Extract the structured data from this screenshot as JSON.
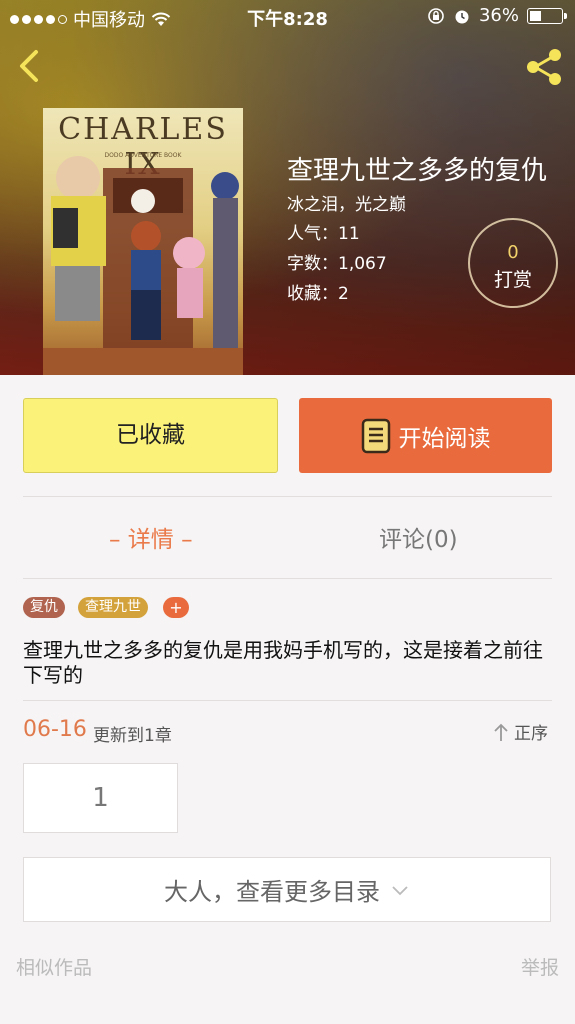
{
  "status_bar": {
    "carrier": "中国移动",
    "time": "下午8:28",
    "battery": "36%",
    "battery_level": 0.36
  },
  "book": {
    "title": "查理九世之多多的复仇",
    "author": "冰之泪，光之巅",
    "popularity": "人气：11",
    "word_count": "字数：1,067",
    "favorites": "收藏：2",
    "cover_title": "CHARLES IX",
    "cover_subtitle": "DODO ADVENTURE BOOK"
  },
  "tip": {
    "count": "0",
    "label": "打赏"
  },
  "actions": {
    "collected": "已收藏",
    "read": "开始阅读"
  },
  "tabs": {
    "detail": "– 详情 –",
    "comment": "评论(0)"
  },
  "tags": [
    "复仇",
    "查理九世",
    "+"
  ],
  "description": "查理九世之多多的复仇是用我妈手机写的，这是接着之前往下写的",
  "update": {
    "date": "06-16",
    "text": "更新到1章",
    "sort": "正序"
  },
  "chapters": [
    "1"
  ],
  "more_catalog": "大人，查看更多目录",
  "footer": {
    "similar": "相似作品",
    "report": "举报"
  },
  "colors": {
    "accent": "#e96b3d",
    "collected": "#fbf27a",
    "tag_orange": "#d3a23a",
    "tag_brown": "#b0634e"
  },
  "icons": [
    "back-icon",
    "share-icon",
    "book-icon",
    "sort-up-icon",
    "chevron-down-icon",
    "wifi-icon",
    "lock-rotation-icon",
    "alarm-icon",
    "battery-icon"
  ]
}
